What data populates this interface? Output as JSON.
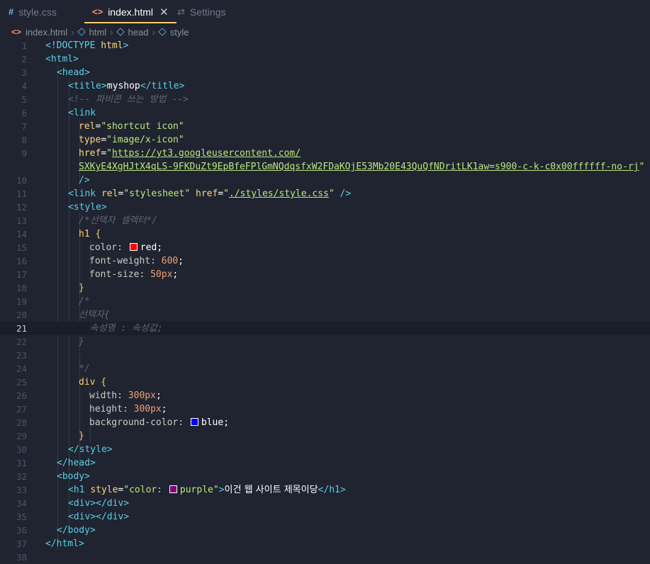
{
  "tabs": [
    {
      "label": "style.css",
      "icon": "#",
      "icon_name": "css-hash-icon"
    },
    {
      "label": "index.html",
      "icon": "<>",
      "icon_name": "html-brackets-icon"
    },
    {
      "label": "Settings",
      "icon": "⇄",
      "icon_name": "settings-icon"
    }
  ],
  "breadcrumb": [
    "index.html",
    "html",
    "head",
    "style"
  ],
  "colors": {
    "red": "#ff0000",
    "blue": "#0000ff",
    "purple": "#800080",
    "accent": "#ffcc66"
  },
  "code": {
    "l1": [
      "<!DOCTYPE ",
      "html",
      ">"
    ],
    "l2": [
      "<",
      "html",
      ">"
    ],
    "l3": [
      "<",
      "head",
      ">"
    ],
    "l4": [
      "<",
      "title",
      ">",
      "myshop",
      "</",
      "title",
      ">"
    ],
    "l5": "<!-- 파비콘 쓰는 방법 -->",
    "l6": [
      "<",
      "link"
    ],
    "l7": [
      "rel",
      "=",
      "\"shortcut icon\""
    ],
    "l8": [
      "type",
      "=",
      "\"image/x-icon\""
    ],
    "l9a": [
      "href",
      "=",
      "\"",
      "https://yt3.googleusercontent.com/"
    ],
    "l9b": [
      "SXKyE4XgHJtX4qLS-9FKDuZt9EpBfeFPlGmNQdqsfxW2FDaKOjE53Mb20E43QuQfNDritLK1aw=s900-c-k-c0x00ffffff-no-rj",
      "\""
    ],
    "l10": "/>",
    "l11": [
      "<",
      "link",
      " ",
      "rel",
      "=",
      "\"stylesheet\"",
      " ",
      "href",
      "=",
      "\"",
      "./styles/style.css",
      "\"",
      " />"
    ],
    "l12": [
      "<",
      "style",
      ">"
    ],
    "l13": "/*선택자 셀렉터*/",
    "l14": [
      "h1",
      " {"
    ],
    "l15": [
      "color",
      ": ",
      "red",
      ";"
    ],
    "l16": [
      "font-weight",
      ": ",
      "600",
      ";"
    ],
    "l17": [
      "font-size",
      ": ",
      "50px",
      ";"
    ],
    "l18": "}",
    "l19": "/*",
    "l20": "선택자{",
    "l21": "  속성명 : 속성값;",
    "l22": "}",
    "l24": "*/",
    "l25": [
      "div",
      " {"
    ],
    "l26": [
      "width",
      ": ",
      "300px",
      ";"
    ],
    "l27": [
      "height",
      ": ",
      "300px",
      ";"
    ],
    "l28": [
      "background-color",
      ": ",
      "blue",
      ";"
    ],
    "l29": "}",
    "l30": [
      "</",
      "style",
      ">"
    ],
    "l31": [
      "</",
      "head",
      ">"
    ],
    "l32": [
      "<",
      "body",
      ">"
    ],
    "l33": [
      "<",
      "h1",
      " ",
      "style",
      "=",
      "\"color: ",
      "purple",
      "\"",
      ">",
      "이건 웹 사이트 제목이당",
      "</",
      "h1",
      ">"
    ],
    "l34": [
      "<",
      "div",
      "></",
      "div",
      ">"
    ],
    "l35": [
      "<",
      "div",
      "></",
      "div",
      ">"
    ],
    "l36": [
      "</",
      "body",
      ">"
    ],
    "l37": [
      "</",
      "html",
      ">"
    ]
  },
  "line_numbers": [
    "1",
    "2",
    "3",
    "4",
    "5",
    "6",
    "7",
    "8",
    "9",
    "10",
    "11",
    "12",
    "13",
    "14",
    "15",
    "16",
    "17",
    "18",
    "19",
    "20",
    "21",
    "22",
    "23",
    "24",
    "25",
    "26",
    "27",
    "28",
    "29",
    "30",
    "31",
    "32",
    "33",
    "34",
    "35",
    "36",
    "37",
    "38"
  ],
  "current_line": "21"
}
